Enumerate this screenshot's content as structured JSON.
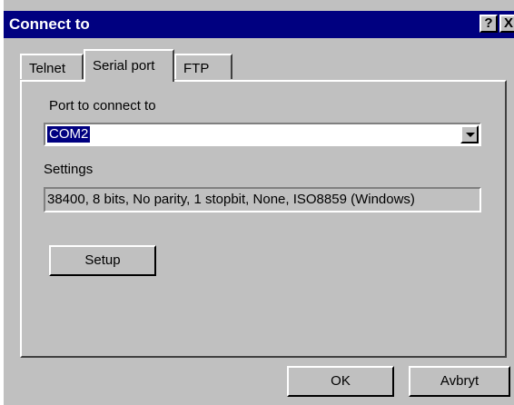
{
  "window": {
    "title": "Connect to",
    "help_label": "?",
    "close_label": "X"
  },
  "tabs": [
    {
      "label": "Telnet",
      "active": false
    },
    {
      "label": "Serial port",
      "active": true
    },
    {
      "label": "FTP",
      "active": false
    }
  ],
  "serial": {
    "port_label": "Port to connect to",
    "port_value": "COM2",
    "settings_label": "Settings",
    "settings_value": "38400, 8 bits, No parity, 1 stopbit, None, ISO8859 (Windows)",
    "setup_label": "Setup"
  },
  "footer": {
    "ok_label": "OK",
    "cancel_label": "Avbryt"
  },
  "colors": {
    "titlebar": "#000080",
    "face": "#c0c0c0",
    "selection": "#000080"
  }
}
